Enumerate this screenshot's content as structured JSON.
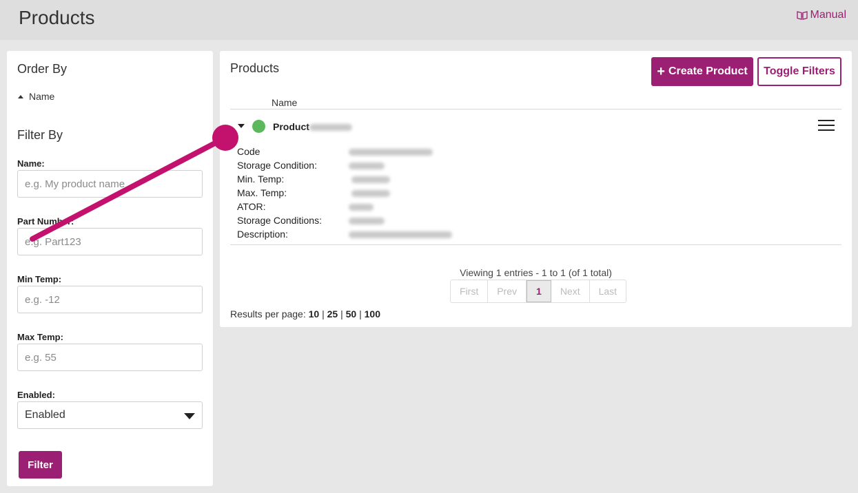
{
  "header": {
    "title": "Products",
    "manual_label": "Manual"
  },
  "sidebar": {
    "order_by_heading": "Order By",
    "order_item": "Name",
    "filter_by_heading": "Filter By",
    "fields": {
      "name": {
        "label": "Name:",
        "placeholder": "e.g. My product name"
      },
      "part_number": {
        "label": "Part Number:",
        "placeholder": "e.g. Part123"
      },
      "min_temp": {
        "label": "Min Temp:",
        "placeholder": "e.g. -12"
      },
      "max_temp": {
        "label": "Max Temp:",
        "placeholder": "e.g. 55"
      },
      "enabled": {
        "label": "Enabled:",
        "value": "Enabled"
      }
    },
    "filter_button": "Filter"
  },
  "main": {
    "title": "Products",
    "create_button": "Create Product",
    "create_icon": "+",
    "toggle_button": "Toggle Filters",
    "column_header": "Name",
    "row": {
      "name": "Product",
      "status_color": "#5cb85c",
      "details": [
        "Code",
        "Storage Condition:",
        "Min. Temp:",
        "Max. Temp:",
        "ATOR:",
        "Storage Conditions:",
        "Description:"
      ]
    },
    "viewing_text": "Viewing 1 entries - 1 to 1 (of 1 total)",
    "pager": {
      "first": "First",
      "prev": "Prev",
      "current": "1",
      "next": "Next",
      "last": "Last"
    },
    "per_page_label": "Results per page:",
    "per_page_options": [
      "10",
      "25",
      "50",
      "100"
    ]
  },
  "colors": {
    "accent": "#9b1f72",
    "annotation": "#c2126e"
  }
}
